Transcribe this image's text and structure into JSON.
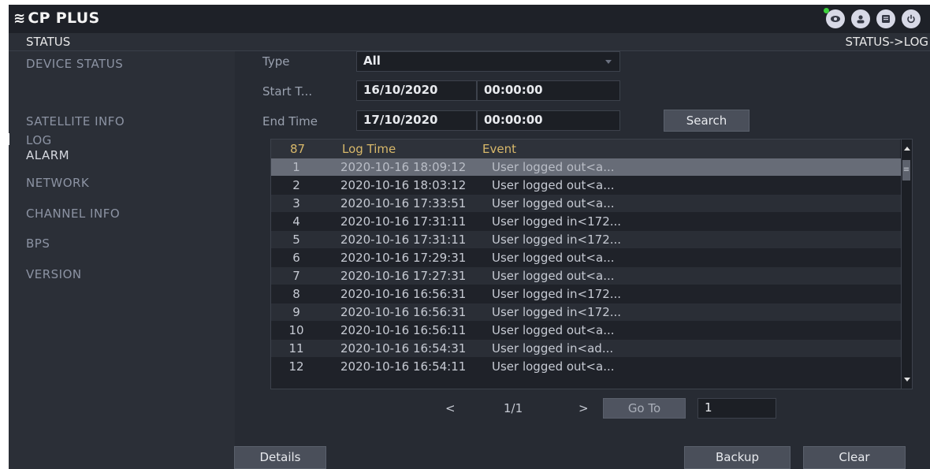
{
  "header": {
    "logo_mark": "≋",
    "logo_text": "CP PLUS",
    "icons": [
      "eye-icon",
      "user-icon",
      "menu-icon",
      "power-icon"
    ],
    "status_dot_color": "#3bd03b"
  },
  "subbar": {
    "title": "STATUS",
    "breadcrumb": "STATUS->LOG"
  },
  "sidebar": {
    "items": [
      {
        "label": "DEVICE STATUS"
      },
      {
        "label": "LOG"
      },
      {
        "label": "SATELLITE INFO"
      },
      {
        "label": "ALARM"
      },
      {
        "label": "NETWORK"
      },
      {
        "label": "CHANNEL INFO"
      },
      {
        "label": "BPS"
      },
      {
        "label": "VERSION"
      }
    ]
  },
  "form": {
    "type_label": "Type",
    "type_value": "All",
    "start_label": "Start T...",
    "start_date": "16/10/2020",
    "start_time": "00:00:00",
    "end_label": "End Time",
    "end_date": "17/10/2020",
    "end_time": "00:00:00",
    "search_label": "Search"
  },
  "table": {
    "count": "87",
    "col_time": "Log Time",
    "col_event": "Event",
    "scroll_thumb_glyph": "≡",
    "rows": [
      {
        "num": "1",
        "time": "2020-10-16 18:09:12",
        "event": "User logged out<a..."
      },
      {
        "num": "2",
        "time": "2020-10-16 18:03:12",
        "event": "User logged out<a..."
      },
      {
        "num": "3",
        "time": "2020-10-16 17:33:51",
        "event": "User logged out<a..."
      },
      {
        "num": "4",
        "time": "2020-10-16 17:31:11",
        "event": "User logged in<172..."
      },
      {
        "num": "5",
        "time": "2020-10-16 17:31:11",
        "event": "User logged in<172..."
      },
      {
        "num": "6",
        "time": "2020-10-16 17:29:31",
        "event": "User logged out<a..."
      },
      {
        "num": "7",
        "time": "2020-10-16 17:27:31",
        "event": "User logged out<a..."
      },
      {
        "num": "8",
        "time": "2020-10-16 16:56:31",
        "event": "User logged in<172..."
      },
      {
        "num": "9",
        "time": "2020-10-16 16:56:31",
        "event": "User logged in<172..."
      },
      {
        "num": "10",
        "time": "2020-10-16 16:56:11",
        "event": "User logged out<a..."
      },
      {
        "num": "11",
        "time": "2020-10-16 16:54:31",
        "event": "User logged in<ad..."
      },
      {
        "num": "12",
        "time": "2020-10-16 16:54:11",
        "event": "User logged out<a..."
      }
    ]
  },
  "pagination": {
    "prev": "<",
    "page": "1/1",
    "next": ">",
    "goto_label": "Go To",
    "goto_value": "1"
  },
  "footer": {
    "details_label": "Details",
    "backup_label": "Backup",
    "clear_label": "Clear"
  }
}
